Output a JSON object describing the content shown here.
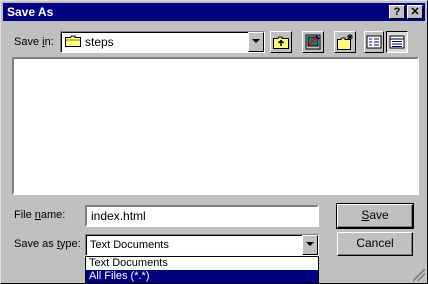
{
  "window": {
    "title": "Save As"
  },
  "savein": {
    "label_pre": "Save ",
    "label_u": "i",
    "label_post": "n:",
    "value": "steps"
  },
  "filename": {
    "label_pre": "File ",
    "label_u": "n",
    "label_post": "ame:",
    "value": "index.html"
  },
  "saveastype": {
    "label_pre": "Save as ",
    "label_u": "t",
    "label_post": "ype:",
    "value": "Text Documents",
    "options": [
      "Text Documents",
      "All Files (*.*)"
    ],
    "selected_index": 1
  },
  "buttons": {
    "save_u": "S",
    "save_rest": "ave",
    "cancel": "Cancel",
    "help": "?",
    "close": "✕"
  },
  "icons": {
    "titlebar": [
      "help-icon",
      "close-icon"
    ],
    "toolbar": [
      "up-one-level-icon",
      "desktop-icon",
      "new-folder-icon",
      "list-view-icon",
      "details-view-icon"
    ]
  }
}
